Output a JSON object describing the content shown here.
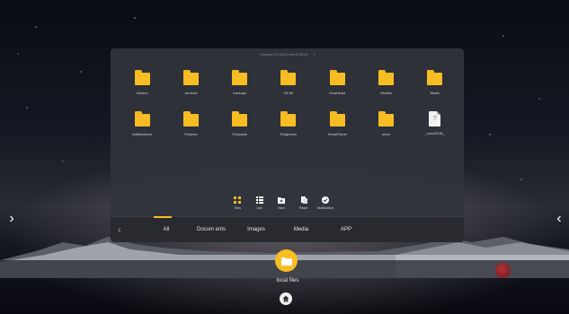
{
  "window": {
    "path": "ereload 12-0010 lmm 00:0f:00",
    "path_sep": "|"
  },
  "files": [
    {
      "name": "Alarms",
      "type": "folder"
    },
    {
      "name": "Android",
      "type": "folder"
    },
    {
      "name": "backups",
      "type": "folder"
    },
    {
      "name": "DCIM",
      "type": "folder"
    },
    {
      "name": "Download",
      "type": "folder"
    },
    {
      "name": "Movies",
      "type": "folder"
    },
    {
      "name": "Music",
      "type": "folder"
    },
    {
      "name": "Notifications",
      "type": "folder"
    },
    {
      "name": "Pictures",
      "type": "folder"
    },
    {
      "name": "Podcasts",
      "type": "folder"
    },
    {
      "name": "Ringtones",
      "type": "folder"
    },
    {
      "name": "SmartPanel",
      "type": "folder"
    },
    {
      "name": "store",
      "type": "folder"
    },
    {
      "name": "_sdcdDOB_",
      "type": "file",
      "icon_glyph": "?"
    }
  ],
  "toolbar": {
    "tiles_label": "Tiles",
    "list_label": "List",
    "new_label": "New",
    "paste_label": "Paste",
    "multiselect_label": "Multiselect"
  },
  "tabs": {
    "back_glyph": "‹",
    "all": "All",
    "documents": "Docum ents",
    "images": "Images",
    "media": "Media",
    "app": "APP",
    "active": "All"
  },
  "nav": {
    "left_arrow": "›",
    "right_arrow": "‹"
  },
  "dock": {
    "label": "local files"
  },
  "colors": {
    "accent": "#f7bd23",
    "window_bg": "#30333a",
    "record": "#b4343a"
  }
}
